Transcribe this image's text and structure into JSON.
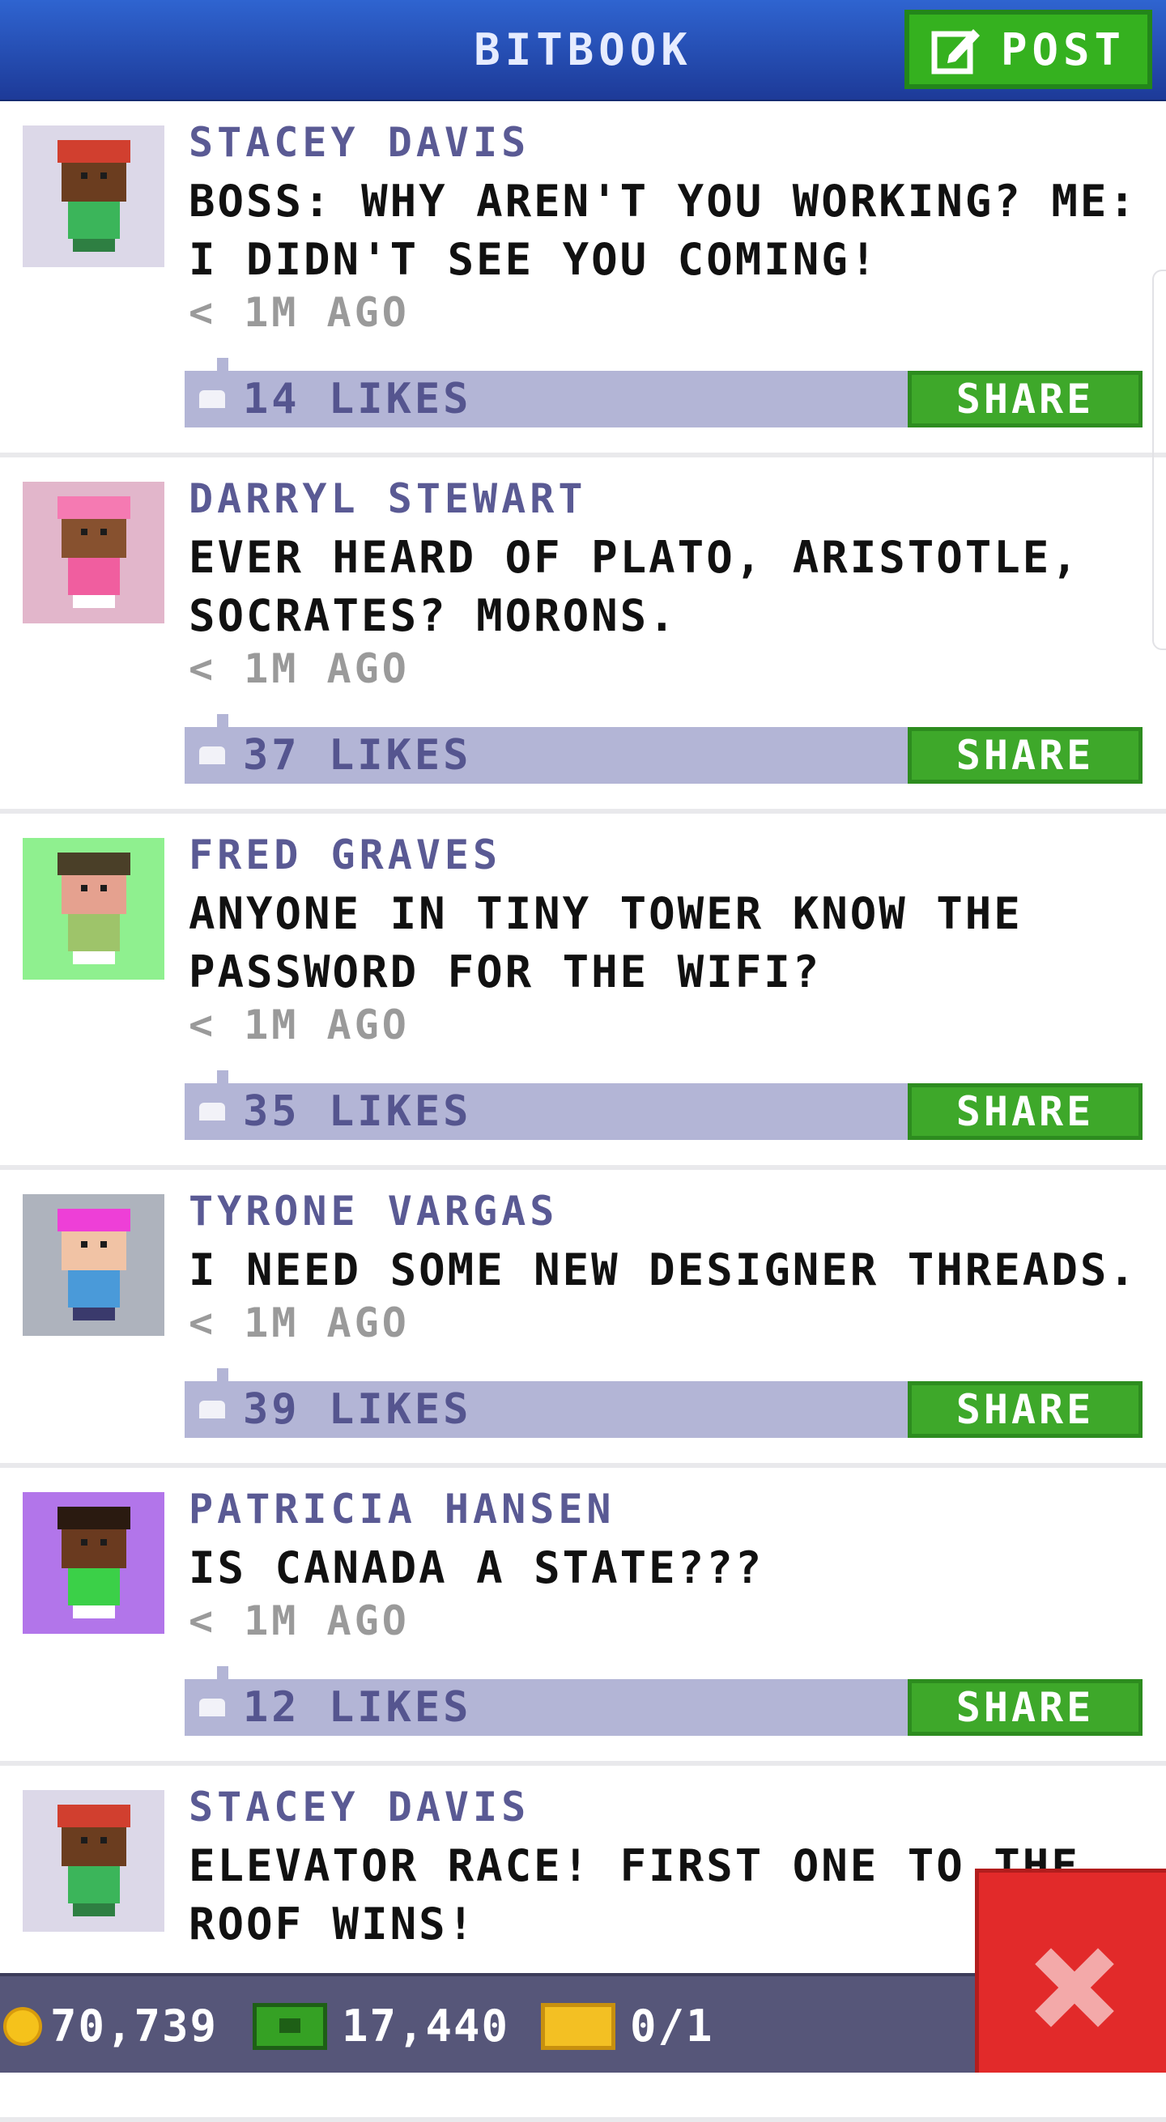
{
  "header": {
    "title": "BITBOOK",
    "post_label": "POST",
    "post_icon": "compose-icon"
  },
  "feed": {
    "share_label": "SHARE",
    "like_icon": "thumbs-up-icon",
    "posts": [
      {
        "author": "STACEY DAVIS",
        "text": "BOSS: WHY AREN'T YOU WORKING? ME: I DIDN'T SEE YOU COMING!",
        "time": "< 1M AGO",
        "likes": "14 LIKES",
        "avatar": {
          "bg": "#dcd8e8",
          "hair": "#d13f2f",
          "skin": "#6b3d1f",
          "shirt": "#3bb55a",
          "legs": "#2e7f42"
        }
      },
      {
        "author": "DARRYL STEWART",
        "text": "EVER HEARD OF PLATO, ARISTOTLE, SOCRATES? MORONS.",
        "time": "< 1M AGO",
        "likes": "37 LIKES",
        "avatar": {
          "bg": "#e2b6cb",
          "hair": "#f57ab2",
          "skin": "#87512f",
          "shirt": "#f05e9f",
          "legs": "#ffffff"
        }
      },
      {
        "author": "FRED GRAVES",
        "text": "ANYONE IN TINY TOWER KNOW THE PASSWORD FOR THE WIFI?",
        "time": "< 1M AGO",
        "likes": "35 LIKES",
        "avatar": {
          "bg": "#8ff08f",
          "hair": "#4a3f28",
          "skin": "#e5a18f",
          "shirt": "#9ec46a",
          "legs": "#ffffff"
        }
      },
      {
        "author": "TYRONE VARGAS",
        "text": "I NEED SOME NEW DESIGNER THREADS.",
        "time": "< 1M AGO",
        "likes": "39 LIKES",
        "avatar": {
          "bg": "#aeb3bd",
          "hair": "#ee3fd7",
          "skin": "#f1c3a5",
          "shirt": "#4a9ad9",
          "legs": "#3a3a6c"
        }
      },
      {
        "author": "PATRICIA HANSEN",
        "text": "IS CANADA A STATE???",
        "time": "< 1M AGO",
        "likes": "12 LIKES",
        "avatar": {
          "bg": "#b275ea",
          "hair": "#2a1a10",
          "skin": "#6a3a1f",
          "shirt": "#3bd048",
          "legs": "#ffffff"
        }
      },
      {
        "author": "STACEY DAVIS",
        "text": "ELEVATOR RACE! FIRST ONE TO THE ROOF WINS!",
        "time": "",
        "likes": "",
        "avatar": {
          "bg": "#dcd8e8",
          "hair": "#d13f2f",
          "skin": "#6b3d1f",
          "shirt": "#3bb55a",
          "legs": "#2e7f42"
        }
      }
    ]
  },
  "bottom_bar": {
    "coins": "70,739",
    "coin_icon": "coin-icon",
    "bux": "17,440",
    "bux_icon": "bux-icon",
    "tickets": "0/1",
    "ticket_icon": "ticket-icon"
  },
  "close_icon": "close-icon"
}
